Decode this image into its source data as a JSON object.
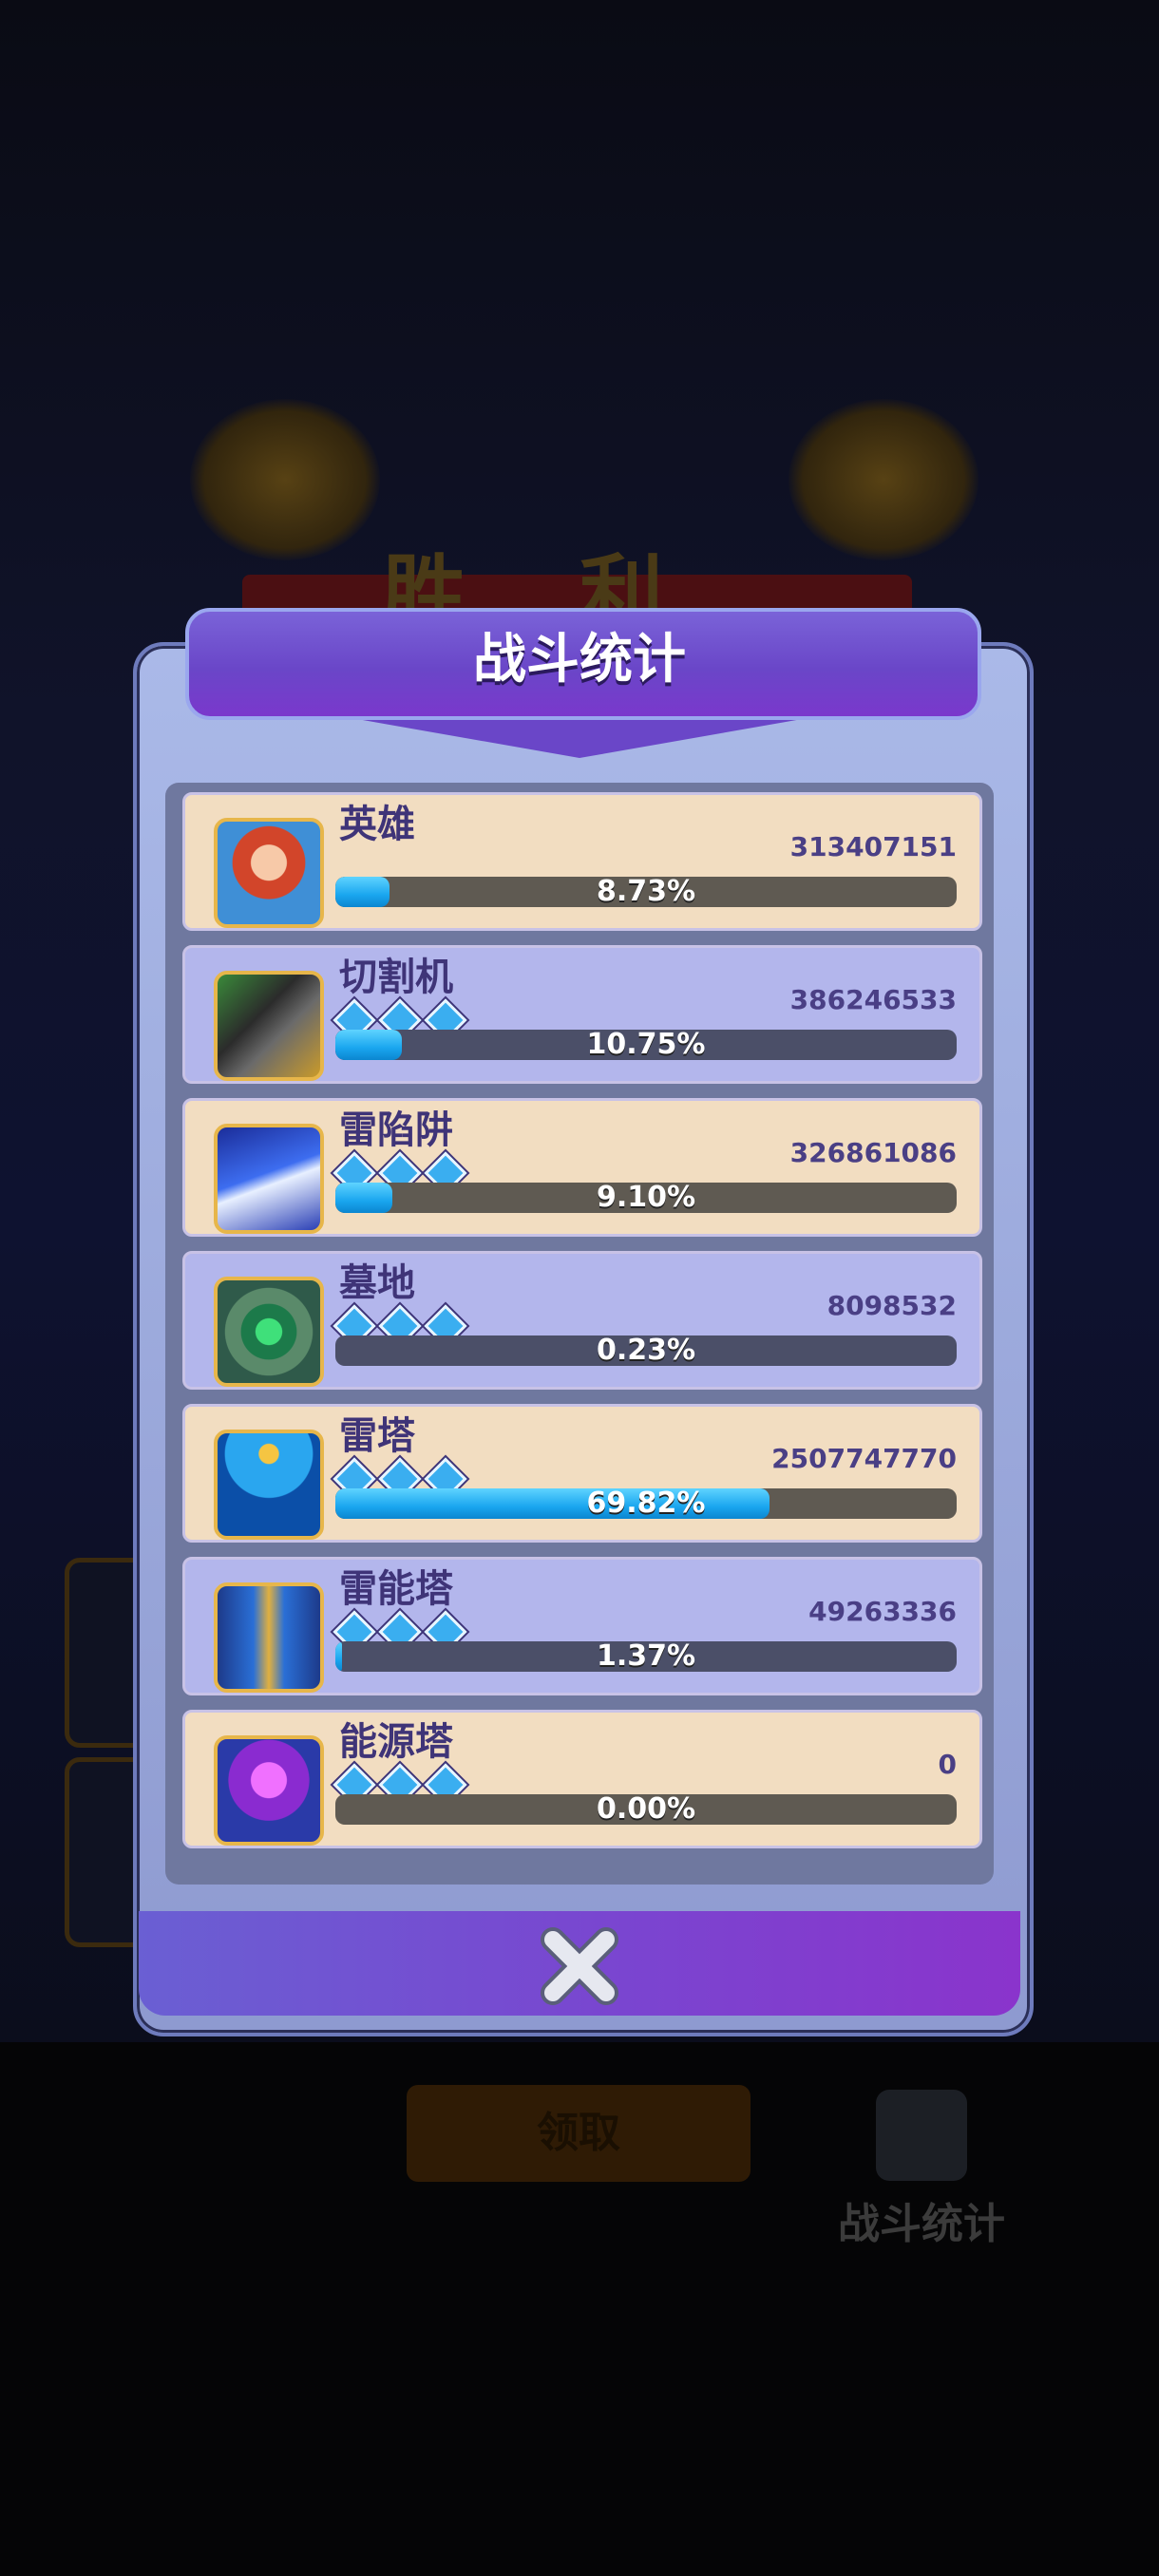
{
  "background": {
    "victory_text": "胜利",
    "claim_button_label": "领取",
    "battle_stats_button_label": "战斗统计"
  },
  "modal": {
    "title": "战斗统计",
    "close_icon": "close-x-icon",
    "bar_fill_color": "#1aa6ef",
    "rows": [
      {
        "name": "英雄",
        "value": "313407151",
        "percent_label": "8.73%",
        "percent": 8.73,
        "gems": 0,
        "icon": "hero-elf-portrait-icon"
      },
      {
        "name": "切割机",
        "value": "386246533",
        "percent_label": "10.75%",
        "percent": 10.75,
        "gems": 3,
        "icon": "spiked-cutter-icon"
      },
      {
        "name": "雷陷阱",
        "value": "326861086",
        "percent_label": "9.10%",
        "percent": 9.1,
        "gems": 3,
        "icon": "thunder-trap-icon"
      },
      {
        "name": "墓地",
        "value": "8098532",
        "percent_label": "0.23%",
        "percent": 0.23,
        "gems": 3,
        "icon": "graveyard-rune-icon"
      },
      {
        "name": "雷塔",
        "value": "2507747770",
        "percent_label": "69.82%",
        "percent": 69.82,
        "gems": 3,
        "icon": "tesla-coil-tower-icon"
      },
      {
        "name": "雷能塔",
        "value": "49263336",
        "percent_label": "1.37%",
        "percent": 1.37,
        "gems": 3,
        "icon": "thunder-energy-tower-icon"
      },
      {
        "name": "能源塔",
        "value": "0",
        "percent_label": "0.00%",
        "percent": 0.0,
        "gems": 3,
        "icon": "energy-crystal-tower-icon"
      }
    ]
  }
}
